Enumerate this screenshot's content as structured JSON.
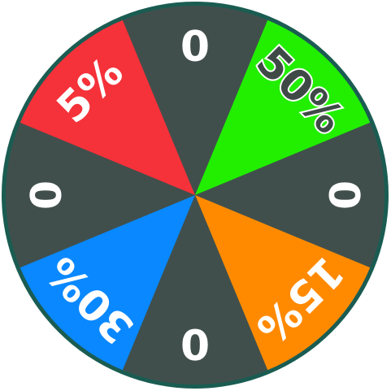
{
  "wheel": {
    "rim_color": "#1a5c52",
    "segments": [
      {
        "label": "0",
        "color": "#414f4c",
        "text_style": "light"
      },
      {
        "label": "50%",
        "color": "#22ee00",
        "text_style": "dark"
      },
      {
        "label": "0",
        "color": "#414f4c",
        "text_style": "light"
      },
      {
        "label": "15%",
        "color": "#ff8a00",
        "text_style": "light"
      },
      {
        "label": "0",
        "color": "#414f4c",
        "text_style": "light"
      },
      {
        "label": "30%",
        "color": "#0a88ff",
        "text_style": "light"
      },
      {
        "label": "0",
        "color": "#414f4c",
        "text_style": "light"
      },
      {
        "label": "5%",
        "color": "#f5313a",
        "text_style": "light"
      }
    ]
  }
}
